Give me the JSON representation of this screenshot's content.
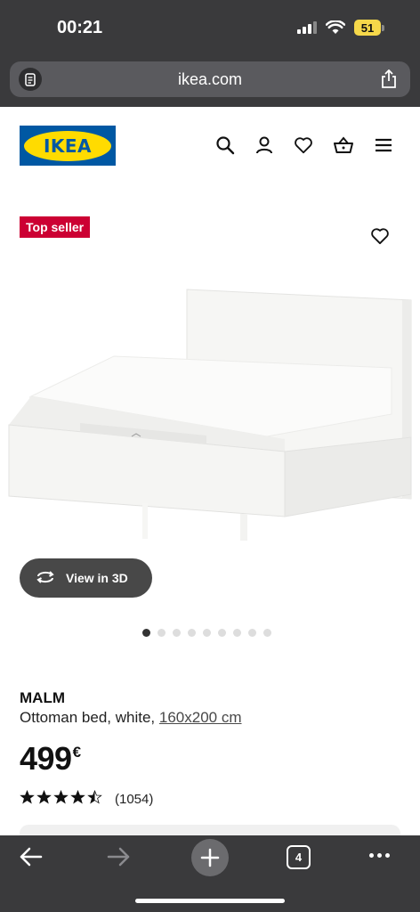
{
  "status": {
    "time": "00:21",
    "battery": "51"
  },
  "browser": {
    "url": "ikea.com",
    "tab_count": "4"
  },
  "site": {
    "logo_text": "IKEA"
  },
  "product": {
    "badge": "Top seller",
    "view3d_label": "View in 3D",
    "name": "MALM",
    "description": "Ottoman bed, white, ",
    "size_link": "160x200 cm",
    "price": "499",
    "currency": "€",
    "rating": 4.5,
    "review_count": "(1054)",
    "image_count": 9,
    "active_image": 1
  },
  "colors": {
    "ikea_blue": "#0058a3",
    "ikea_yellow": "#ffdb00",
    "badge_red": "#cc0033",
    "chrome": "#3a3a3c"
  }
}
